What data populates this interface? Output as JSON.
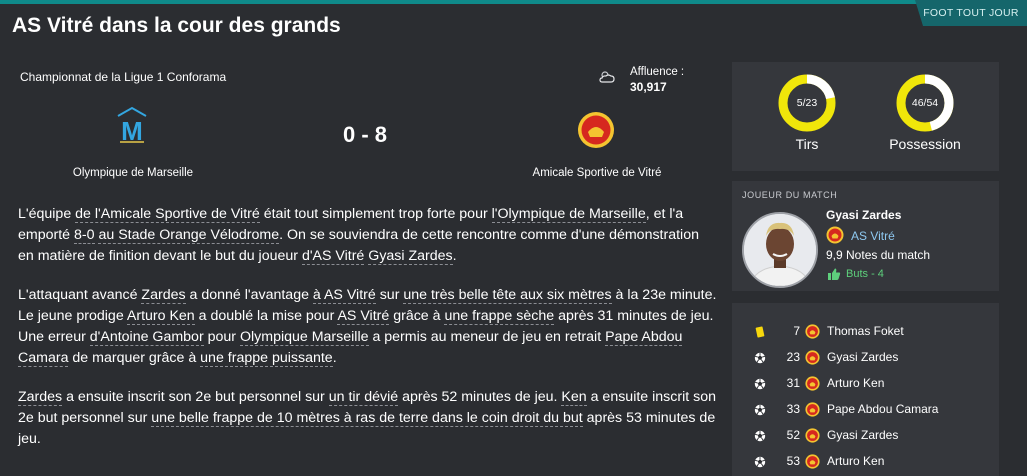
{
  "header": {
    "tag": "FOOT TOUT JOUR",
    "title": "AS Vitré dans la cour des grands"
  },
  "match": {
    "competition": "Championnat de la Ligue 1 Conforama",
    "attendance_label": "Affluence :",
    "attendance": "30,917",
    "home_team": "Olympique de Marseille",
    "away_team": "Amicale Sportive de Vitré",
    "score": "0 - 8"
  },
  "report": {
    "paragraphs": [
      [
        {
          "t": "L'équipe "
        },
        {
          "t": "de l'Amicale Sportive de Vitré",
          "u": true
        },
        {
          "t": " était tout simplement trop forte pour "
        },
        {
          "t": "l'Olympique de Marseille",
          "u": true
        },
        {
          "t": ", et l'a emporté "
        },
        {
          "t": "8-0",
          "u": true
        },
        {
          "t": " "
        },
        {
          "t": "au Stade Orange Vélodrome",
          "u": true
        },
        {
          "t": ". On se souviendra de cette rencontre comme d'une démonstration en matière de finition devant le but du joueur "
        },
        {
          "t": "d'AS Vitré",
          "u": true
        },
        {
          "t": " "
        },
        {
          "t": "Gyasi Zardes",
          "u": true
        },
        {
          "t": "."
        }
      ],
      [
        {
          "t": "L'attaquant avancé "
        },
        {
          "t": "Zardes",
          "u": true
        },
        {
          "t": " a donné l'avantage "
        },
        {
          "t": "à AS Vitré",
          "u": true
        },
        {
          "t": " sur "
        },
        {
          "t": "une très belle tête aux six mètres",
          "u": true
        },
        {
          "t": " à la 23e minute. Le jeune prodige "
        },
        {
          "t": "Arturo Ken",
          "u": true
        },
        {
          "t": " a doublé la mise pour "
        },
        {
          "t": "AS Vitré",
          "u": true
        },
        {
          "t": " grâce à "
        },
        {
          "t": "une frappe sèche",
          "u": true
        },
        {
          "t": " après 31 minutes de jeu. Une erreur "
        },
        {
          "t": "d'Antoine Gambor",
          "u": true
        },
        {
          "t": " pour "
        },
        {
          "t": "Olympique Marseille",
          "u": true
        },
        {
          "t": " a permis au meneur de jeu en retrait "
        },
        {
          "t": "Pape Abdou Camara",
          "u": true
        },
        {
          "t": " de marquer grâce à "
        },
        {
          "t": "une frappe puissante",
          "u": true
        },
        {
          "t": "."
        }
      ],
      [
        {
          "t": "Zardes",
          "u": true
        },
        {
          "t": " a ensuite inscrit son 2e but personnel sur "
        },
        {
          "t": "un tir dévié",
          "u": true
        },
        {
          "t": " après 52 minutes de jeu. "
        },
        {
          "t": "Ken",
          "u": true
        },
        {
          "t": " a ensuite inscrit son 2e but personnel sur "
        },
        {
          "t": "une belle frappe de 10 mètres à ras de terre dans le coin droit du but",
          "u": true
        },
        {
          "t": " après 53 minutes de jeu."
        }
      ]
    ]
  },
  "stats": {
    "shots": {
      "text": "5/23",
      "label": "Tirs",
      "fraction": 0.217
    },
    "possession": {
      "text": "46/54",
      "label": "Possession",
      "fraction": 0.46
    }
  },
  "potm": {
    "header": "JOUEUR DU MATCH",
    "name": "Gyasi Zardes",
    "club": "AS Vitré",
    "rating": "9,9 Notes du match",
    "goals": "Buts - 4"
  },
  "events": [
    {
      "icon": "yellow-card-icon",
      "minute": "7",
      "name": "Thomas Foket"
    },
    {
      "icon": "football-icon",
      "minute": "23",
      "name": "Gyasi Zardes"
    },
    {
      "icon": "football-icon",
      "minute": "31",
      "name": "Arturo Ken"
    },
    {
      "icon": "football-icon",
      "minute": "33",
      "name": "Pape Abdou Camara"
    },
    {
      "icon": "football-icon",
      "minute": "52",
      "name": "Gyasi Zardes"
    },
    {
      "icon": "football-icon",
      "minute": "53",
      "name": "Arturo Ken"
    }
  ],
  "colors": {
    "background": "#2b2d31",
    "panel": "#35373c",
    "accent": "#0f8a8a",
    "donut_yellow": "#f0e60a",
    "donut_white": "#ffffff",
    "link_blue": "#8ec8f0",
    "positive_green": "#5ed07c"
  }
}
